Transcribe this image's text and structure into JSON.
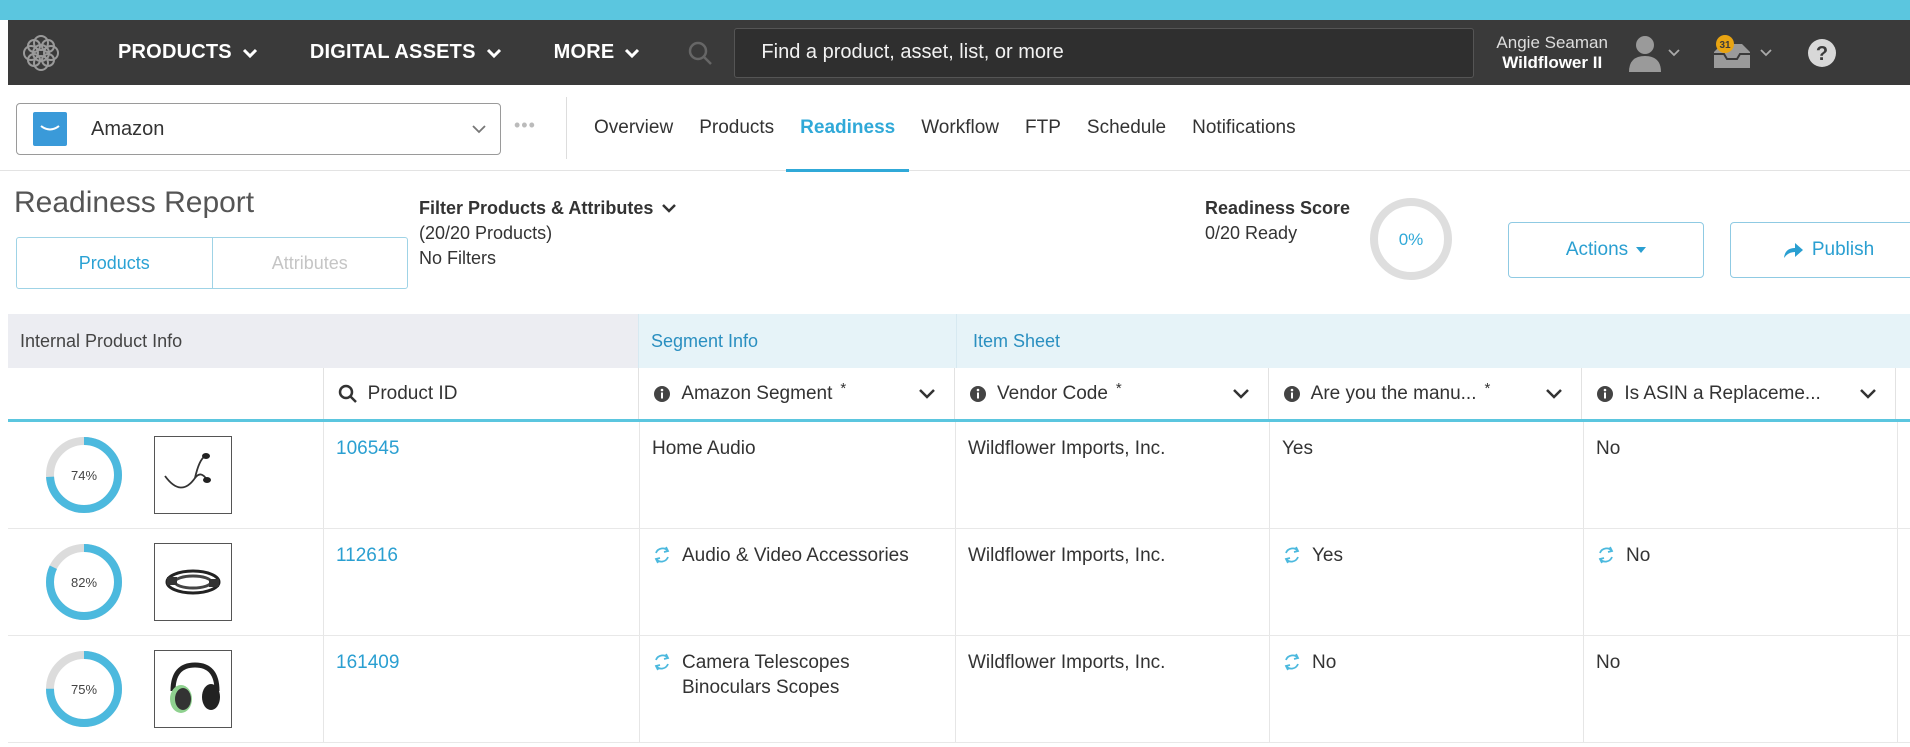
{
  "nav": {
    "items": [
      {
        "label": "PRODUCTS"
      },
      {
        "label": "DIGITAL ASSETS"
      },
      {
        "label": "MORE"
      }
    ],
    "search_placeholder": "Find a product, asset, list, or more",
    "user_name": "Angie Seaman",
    "org_name": "Wildflower II",
    "notification_count": "31"
  },
  "channel": {
    "name": "Amazon",
    "more": "•••"
  },
  "tabs": [
    {
      "label": "Overview"
    },
    {
      "label": "Products"
    },
    {
      "label": "Readiness"
    },
    {
      "label": "Workflow"
    },
    {
      "label": "FTP"
    },
    {
      "label": "Schedule"
    },
    {
      "label": "Notifications"
    }
  ],
  "report": {
    "title": "Readiness Report",
    "toggle": {
      "products": "Products",
      "attributes": "Attributes"
    },
    "filter_title": "Filter Products & Attributes",
    "filter_count": "(20/20 Products)",
    "filter_state": "No Filters",
    "score_title": "Readiness Score",
    "score_ready": "0/20 Ready",
    "score_percent": "0%",
    "actions_label": "Actions",
    "publish_label": "Publish"
  },
  "grid": {
    "groups": {
      "internal": "Internal Product Info",
      "segment": "Segment Info",
      "item": "Item Sheet"
    },
    "columns": {
      "product_id": "Product ID",
      "segment": "Amazon Segment",
      "vendor": "Vendor Code",
      "manufacturer": "Are you the manu...",
      "asin": "Is ASIN a Replaceme...",
      "required_mark": "*"
    },
    "rows": [
      {
        "completion": "74%",
        "completion_value": 0.74,
        "product_id": "106545",
        "segment": "Home Audio",
        "segment_synced": false,
        "vendor": "Wildflower Imports, Inc.",
        "manufacturer": "Yes",
        "manufacturer_synced": false,
        "asin": "No",
        "asin_synced": false
      },
      {
        "completion": "82%",
        "completion_value": 0.82,
        "product_id": "112616",
        "segment": "Audio & Video Accessories",
        "segment_synced": true,
        "vendor": "Wildflower Imports, Inc.",
        "manufacturer": "Yes",
        "manufacturer_synced": true,
        "asin": "No",
        "asin_synced": true
      },
      {
        "completion": "75%",
        "completion_value": 0.75,
        "product_id": "161409",
        "segment": "Camera Telescopes Binoculars Scopes",
        "segment_synced": true,
        "vendor": "Wildflower Imports, Inc.",
        "manufacturer": "No",
        "manufacturer_synced": true,
        "asin": "No",
        "asin_synced": false
      }
    ]
  },
  "colors": {
    "accent": "#30a9d8",
    "navbar": "#3a3a3a",
    "topstrip": "#5bc6df"
  }
}
